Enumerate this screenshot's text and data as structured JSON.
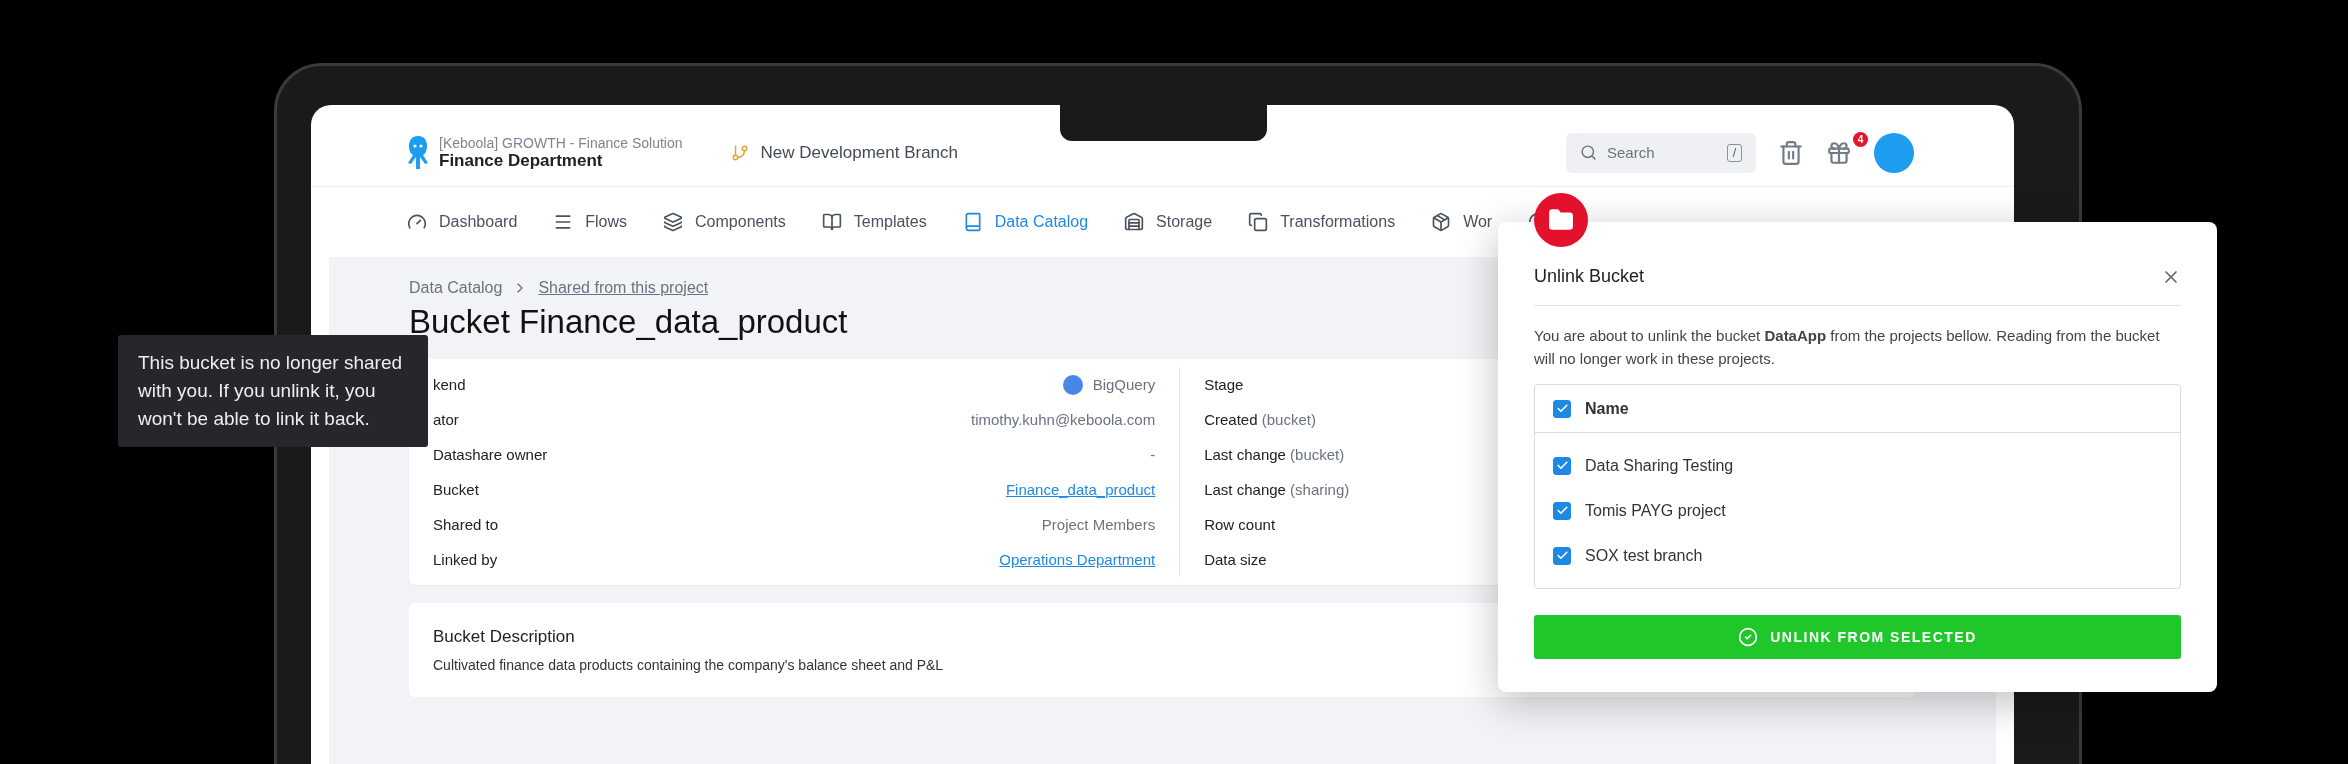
{
  "header": {
    "org": "[Keboola] GROWTH - Finance Solution",
    "project": "Finance Department",
    "branch": "New Development Branch",
    "search": {
      "placeholder": "Search",
      "shortcut": "/"
    },
    "notifications": "4"
  },
  "nav": [
    {
      "label": "Dashboard",
      "selected": false
    },
    {
      "label": "Flows",
      "selected": false
    },
    {
      "label": "Components",
      "selected": false
    },
    {
      "label": "Templates",
      "selected": false
    },
    {
      "label": "Data Catalog",
      "selected": true
    },
    {
      "label": "Storage",
      "selected": false
    },
    {
      "label": "Transformations",
      "selected": false
    },
    {
      "label": "Wor",
      "selected": false
    },
    {
      "selected": false
    }
  ],
  "breadcrumb": [
    {
      "label": "Data Catalog",
      "kind": "text"
    },
    {
      "label": "Shared from this project",
      "kind": "link"
    }
  ],
  "title": "Bucket Finance_data_product",
  "details_left": [
    {
      "label": "kend",
      "value": "BigQuery",
      "kind": "backend"
    },
    {
      "label": "ator",
      "value": "timothy.kuhn@keboola.com",
      "kind": "text"
    },
    {
      "label": "Datashare owner",
      "value": "-",
      "kind": "text"
    },
    {
      "label": "Bucket",
      "value": "Finance_data_product",
      "kind": "link"
    },
    {
      "label": "Shared to",
      "value": "Project Members",
      "kind": "text"
    },
    {
      "label": "Linked by",
      "value": "Operations Department",
      "kind": "link"
    }
  ],
  "details_right": [
    {
      "label": "Stage"
    },
    {
      "label": "Created",
      "note": "(bucket)"
    },
    {
      "label": "Last change",
      "note": "(bucket)"
    },
    {
      "label": "Last change",
      "note": "(sharing)"
    },
    {
      "label": "Row count"
    },
    {
      "label": "Data size"
    }
  ],
  "description": {
    "title": "Bucket Description",
    "text": "Cultivated finance data products containing the company's balance sheet and P&L"
  },
  "tooltip": "This bucket is no longer shared with you. If you unlink it, you won't be able to link it back.",
  "modal": {
    "title": "Unlink Bucket",
    "message": "You are about to unlink the bucket **DataApp** from the projects bellow. Reading from the bucket will no longer work in these projects.",
    "header": {
      "label": "Name",
      "checked": true
    },
    "projects": [
      {
        "label": "Data Sharing Testing",
        "checked": true
      },
      {
        "label": "Tomis PAYG project",
        "checked": true
      },
      {
        "label": "SOX test branch",
        "checked": true
      }
    ],
    "button": "UNLINK FROM SELECTED"
  }
}
